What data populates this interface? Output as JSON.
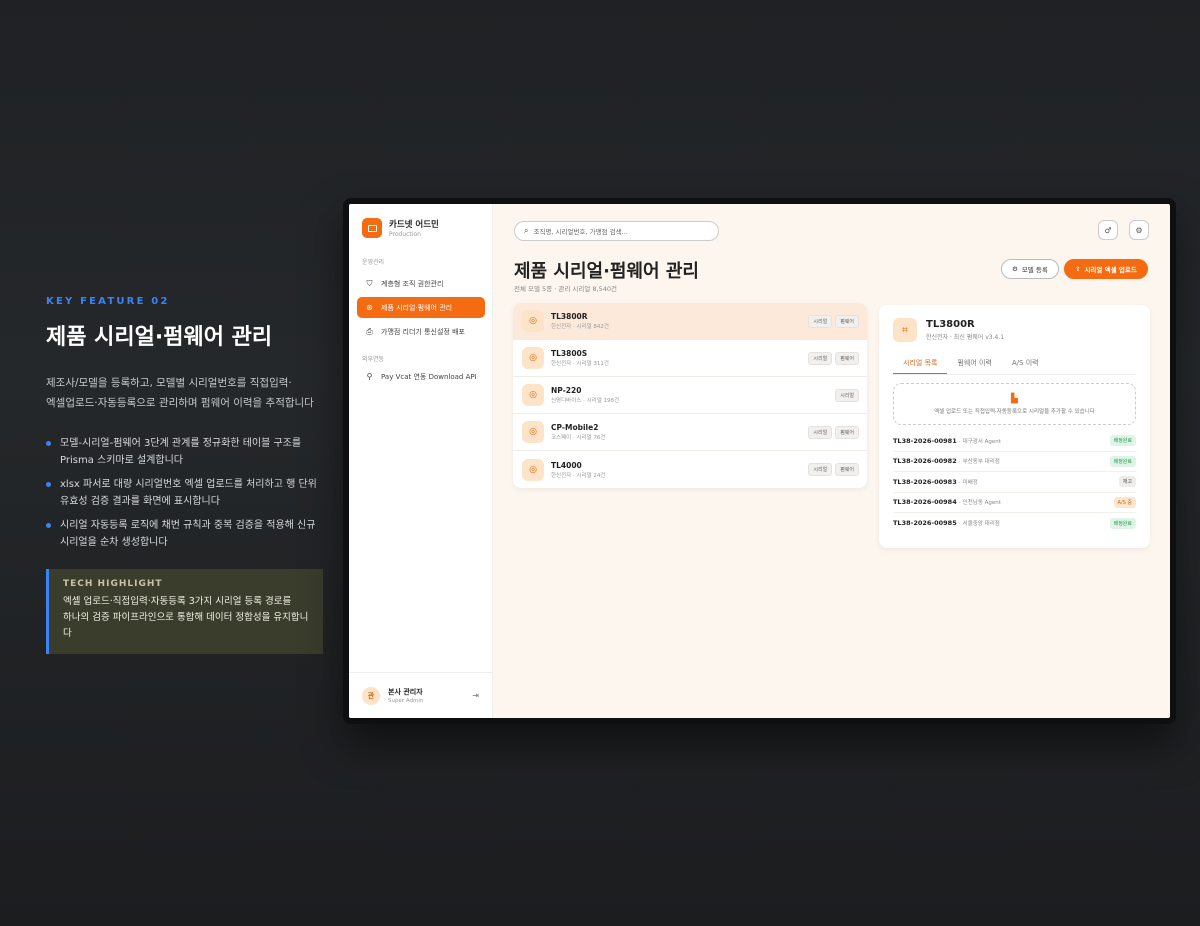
{
  "feature": {
    "kicker": "KEY FEATURE 02",
    "title": "제품 시리얼·펌웨어 관리",
    "description": "제조사/모델을 등록하고, 모델별 시리얼번호를 직접입력·\n엑셀업로드·자동등록으로 관리하며 펌웨어 이력을 추적합니다",
    "bullets": [
      "모델-시리얼-펌웨어 3단계 관계를 정규화한 테이블 구조를 Prisma 스키마로 설계합니다",
      "xlsx 파서로 대량 시리얼번호 엑셀 업로드를 처리하고 행 단위 유효성 검증 결과를 화면에 표시합니다",
      "시리얼 자동등록 로직에 채번 규칙과 중복 검증을 적용해 신규 시리얼을 순차 생성합니다"
    ],
    "tech_highlight": {
      "heading": "TECH HIGHLIGHT",
      "body": "엑셀 업로드·직접입력·자동등록 3가지 시리얼 등록 경로를\n하나의 검증 파이프라인으로 통합해 데이터 정합성을 유지합니다"
    }
  },
  "app": {
    "brand": {
      "name": "카드넷 어드민",
      "env": "Production"
    },
    "sidebar": {
      "section_ops": "운영관리",
      "items": [
        {
          "label": "계층형 조직 권한관리",
          "icon": "shield-icon"
        },
        {
          "label": "제품 시리얼·펌웨어 관리",
          "icon": "chip-icon",
          "active": true
        },
        {
          "label": "가맹점 리더기 통신설정 배포",
          "icon": "printer-icon"
        }
      ],
      "section_ext": "외부연동",
      "ext_items": [
        {
          "label": "Pay Vcat 연동 Download API",
          "icon": "link-icon"
        }
      ],
      "user": {
        "avatar": "관",
        "name": "본사 관리자",
        "role": "Super Admin"
      }
    },
    "search": {
      "placeholder": "조직명, 시리얼번호, 가맹점 검색..."
    },
    "page": {
      "title": "제품 시리얼·펌웨어 관리",
      "subtitle": "전체 모델 5종 · 관리 시리얼 8,540건",
      "btn_model": "모델 등록",
      "btn_upload": "시리얼 엑셀 업로드"
    },
    "models": [
      {
        "name": "TL3800R",
        "sub": "한신전자 · 시리얼 842건",
        "tags": [
          "시리얼",
          "펌웨어"
        ],
        "selected": true
      },
      {
        "name": "TL3800S",
        "sub": "한신전자 · 시리얼 311건",
        "tags": [
          "시리얼",
          "펌웨어"
        ]
      },
      {
        "name": "NP-220",
        "sub": "신명디바이스 · 시리얼 198건",
        "tags": [
          "시리얼"
        ]
      },
      {
        "name": "CP-Mobile2",
        "sub": "코스페이 · 시리얼 76건",
        "tags": [
          "시리얼",
          "펌웨어"
        ]
      },
      {
        "name": "TL4000",
        "sub": "한신전자 · 시리얼 24건",
        "tags": [
          "시리얼",
          "펌웨어"
        ]
      }
    ],
    "detail": {
      "name": "TL3800R",
      "sub": "한신전자 · 최신 펌웨어 v3.4.1",
      "tabs": [
        "시리얼 목록",
        "펌웨어 이력",
        "A/S 이력"
      ],
      "drop_text": "엑셀 업로드 또는 직접입력·자동등록으로 시리얼을 추가할 수 있습니다",
      "serials": [
        {
          "code": "TL38-2026-00981",
          "owner": "대구광서 Agent",
          "status": "배정완료",
          "tone": "green"
        },
        {
          "code": "TL38-2026-00982",
          "owner": "부산동부 대리점",
          "status": "배정완료",
          "tone": "green"
        },
        {
          "code": "TL38-2026-00983",
          "owner": "미배정",
          "status": "재고",
          "tone": "gray"
        },
        {
          "code": "TL38-2026-00984",
          "owner": "인천남동 Agent",
          "status": "A/S 중",
          "tone": "orange"
        },
        {
          "code": "TL38-2026-00985",
          "owner": "서울중앙 대리점",
          "status": "배정완료",
          "tone": "green"
        }
      ]
    }
  }
}
